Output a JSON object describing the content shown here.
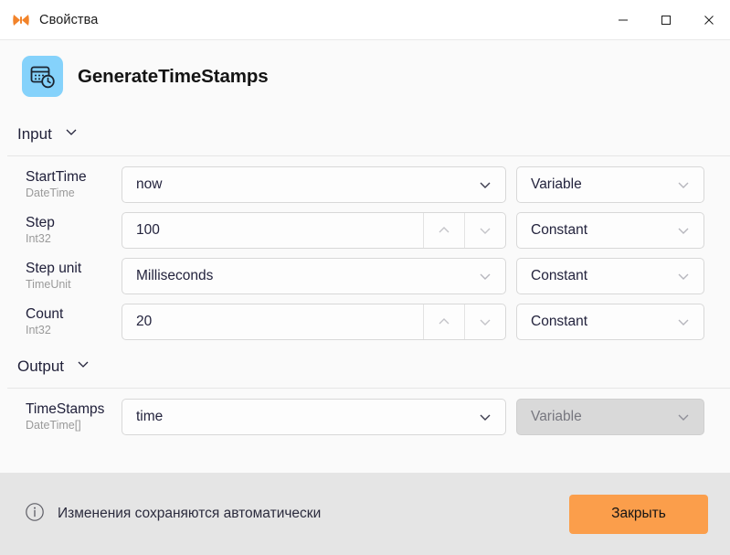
{
  "titlebar": {
    "title": "Свойства",
    "app_icon": "butterfly-icon",
    "minimize_label": "—",
    "maximize_label": "□",
    "close_label": "✕"
  },
  "header": {
    "icon": "calendar-clock-icon",
    "icon_background": "#85d2fb",
    "title": "GenerateTimeStamps"
  },
  "sections": [
    {
      "id": "input",
      "title": "Input",
      "chevron": "chevron-down-icon",
      "rows": [
        {
          "name": "StartTime",
          "type": "DateTime",
          "value": "now",
          "control": "dropdown",
          "mode": "Variable",
          "mode_disabled": false
        },
        {
          "name": "Step",
          "type": "Int32",
          "value": "100",
          "control": "spinner",
          "mode": "Constant",
          "mode_disabled": false
        },
        {
          "name": "Step unit",
          "type": "TimeUnit",
          "value": "Milliseconds",
          "control": "dropdown",
          "mode": "Constant",
          "mode_disabled": false
        },
        {
          "name": "Count",
          "type": "Int32",
          "value": "20",
          "control": "spinner",
          "mode": "Constant",
          "mode_disabled": false
        }
      ]
    },
    {
      "id": "output",
      "title": "Output",
      "chevron": "chevron-down-icon",
      "rows": [
        {
          "name": "TimeStamps",
          "type": "DateTime[]",
          "value": "time",
          "control": "dropdown",
          "mode": "Variable",
          "mode_disabled": true
        }
      ]
    }
  ],
  "footer": {
    "info_icon": "info-circle-icon",
    "note": "Изменения сохраняются автоматически",
    "close_button": "Закрыть",
    "accent_color": "#fb9e4b"
  }
}
